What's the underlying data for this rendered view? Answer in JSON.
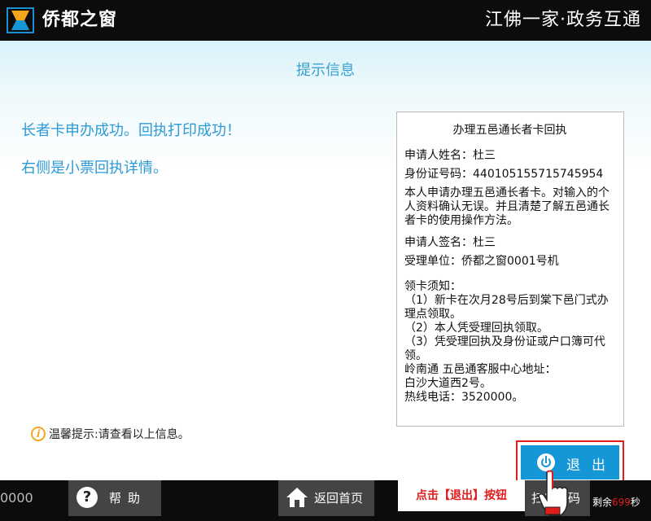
{
  "header": {
    "brand": "侨都之窗",
    "slogan": "江佛一家·政务互通"
  },
  "main": {
    "page_title": "提示信息",
    "message_line1": "长者卡申办成功。回执打印成功！",
    "message_line2": "右侧是小票回执详情。"
  },
  "receipt": {
    "title": "办理五邑通长者卡回执",
    "applicant_name": "申请人姓名：杜三",
    "id_number": "身份证号码：440105155715745954",
    "statement": "本人申请办理五邑通长者卡。对输入的个人资料确认无误。并且清楚了解五邑通长者卡的使用操作方法。",
    "signature": "申请人签名：杜三",
    "handling_unit": "受理单位：侨都之窗0001号机",
    "notice_title": "领卡须知：",
    "notice_1": "（1）新卡在次月28号后到棠下邑门式办理点领取。",
    "notice_2": "（2）本人凭受理回执领取。",
    "notice_3": "（3）凭受理回执及身份证或户口簿可代领。",
    "service_center": "岭南通 五邑通客服中心地址：",
    "address": "白沙大道西2号。",
    "hotline": "热线电话：3520000。"
  },
  "tip": {
    "icon": "i",
    "text": "温馨提示:请查看以上信息。"
  },
  "exit_button": {
    "label": "退出"
  },
  "footer": {
    "counter": "0000",
    "help_label": "帮助",
    "help_icon": "?",
    "home_label": "返回首页",
    "hint": "点击【退出】按钮",
    "scan_label": "扫二维码",
    "remaining_prefix": "剩余",
    "remaining_seconds": "699",
    "remaining_suffix": "秒"
  },
  "colors": {
    "accent_blue": "#1596d6",
    "highlight_red": "#e21b1b",
    "tip_orange": "#f3a61b"
  }
}
